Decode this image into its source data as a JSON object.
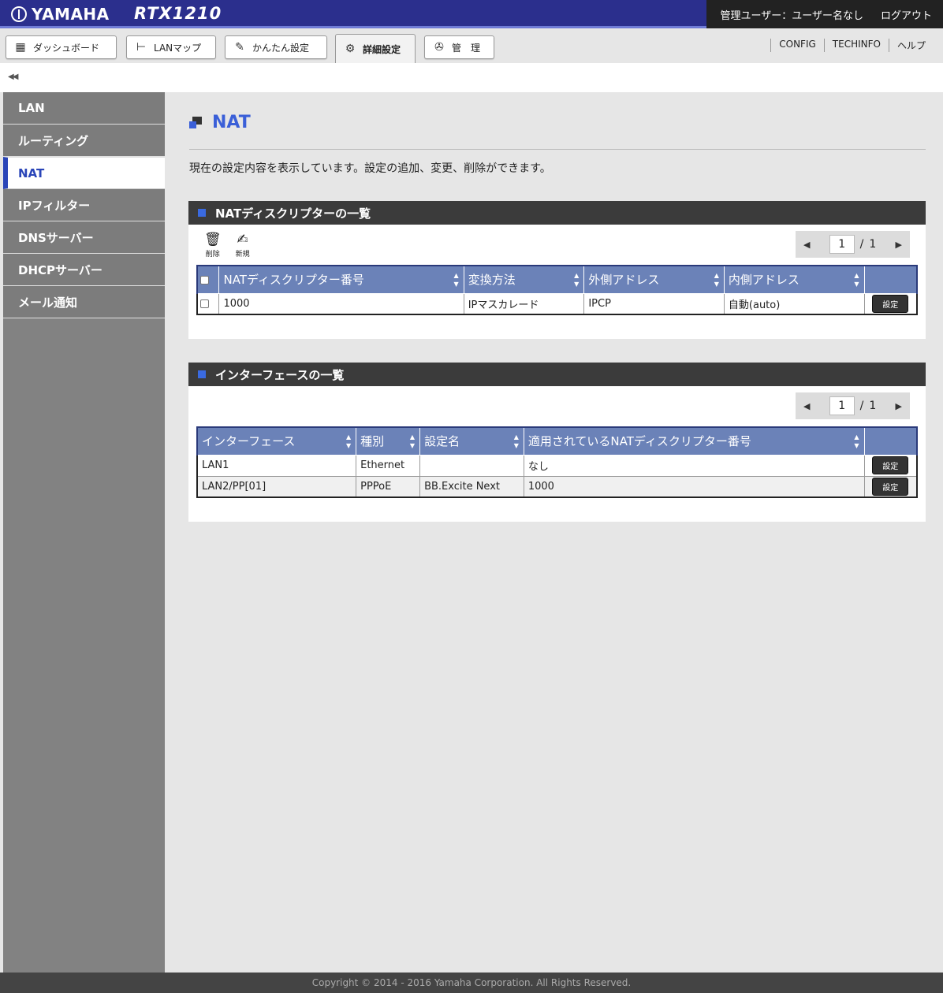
{
  "header": {
    "brand": "YAMAHA",
    "model": "RTX1210",
    "user_label": "管理ユーザー：ユーザー名なし",
    "logout_label": "ログアウト"
  },
  "tabs": [
    {
      "label": "ダッシュボード",
      "icon": "dashboard-icon"
    },
    {
      "label": "LANマップ",
      "icon": "lan-map-icon"
    },
    {
      "label": "かんたん設定",
      "icon": "wizard-icon"
    },
    {
      "label": "詳細設定",
      "icon": "gear-icon"
    },
    {
      "label": "管　理",
      "icon": "wrench-icon"
    }
  ],
  "toplinks": {
    "config": "CONFIG",
    "techinfo": "TECHINFO",
    "help": "ヘルプ"
  },
  "collapse_label": "◀◀",
  "sidebar": {
    "items": [
      {
        "label": "LAN"
      },
      {
        "label": "ルーティング"
      },
      {
        "label": "NAT"
      },
      {
        "label": "IPフィルター"
      },
      {
        "label": "DNSサーバー"
      },
      {
        "label": "DHCPサーバー"
      },
      {
        "label": "メール通知"
      }
    ]
  },
  "page": {
    "title": "NAT",
    "description": "現在の設定内容を表示しています。設定の追加、変更、削除ができます。"
  },
  "nat_panel": {
    "title": "NATディスクリプターの一覧",
    "tools": {
      "delete_label": "削除",
      "new_label": "新規"
    },
    "pager": {
      "current": "1",
      "separator": "/",
      "total": "1"
    },
    "columns": [
      "NATディスクリプター番号",
      "変換方法",
      "外側アドレス",
      "内側アドレス"
    ],
    "rows": [
      {
        "number": "1000",
        "method": "IPマスカレード",
        "outer": "IPCP",
        "inner": "自動(auto)",
        "action": "設定"
      }
    ]
  },
  "if_panel": {
    "title": "インターフェースの一覧",
    "pager": {
      "current": "1",
      "separator": "/",
      "total": "1"
    },
    "columns": [
      "インターフェース",
      "種別",
      "設定名",
      "適用されているNATディスクリプター番号"
    ],
    "rows": [
      {
        "interface": "LAN1",
        "type": "Ethernet",
        "name": "",
        "nat": "なし",
        "action": "設定"
      },
      {
        "interface": "LAN2/PP[01]",
        "type": "PPPoE",
        "name": "BB.Excite Next",
        "nat": "1000",
        "action": "設定"
      }
    ]
  },
  "footer": {
    "copyright": "Copyright © 2014 - 2016 Yamaha Corporation. All Rights Reserved."
  },
  "colors": {
    "header_bg": "#2b2f8d",
    "accent": "#3a5fd8",
    "table_head": "#6b82b8",
    "sidebar": "#7c7c7c"
  }
}
